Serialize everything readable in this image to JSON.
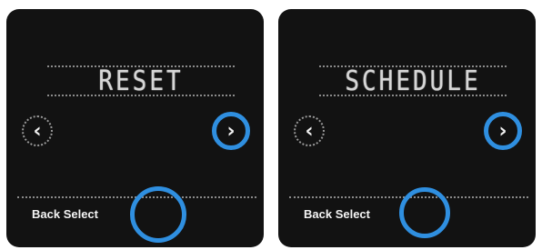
{
  "screens": [
    {
      "title": "RESET",
      "prev_icon": "chevron-left-icon",
      "prev_glyph": "‹",
      "next_icon": "chevron-right-icon",
      "next_glyph": "›",
      "softkeys_label": "Back Select"
    },
    {
      "title": "SCHEDULE",
      "prev_icon": "chevron-left-icon",
      "prev_glyph": "‹",
      "next_icon": "chevron-right-icon",
      "next_glyph": "›",
      "softkeys_label": "Back Select"
    }
  ],
  "colors": {
    "panel_bg": "#121212",
    "highlight_ring": "#2f8fe0",
    "text": "#d6d6d6"
  }
}
